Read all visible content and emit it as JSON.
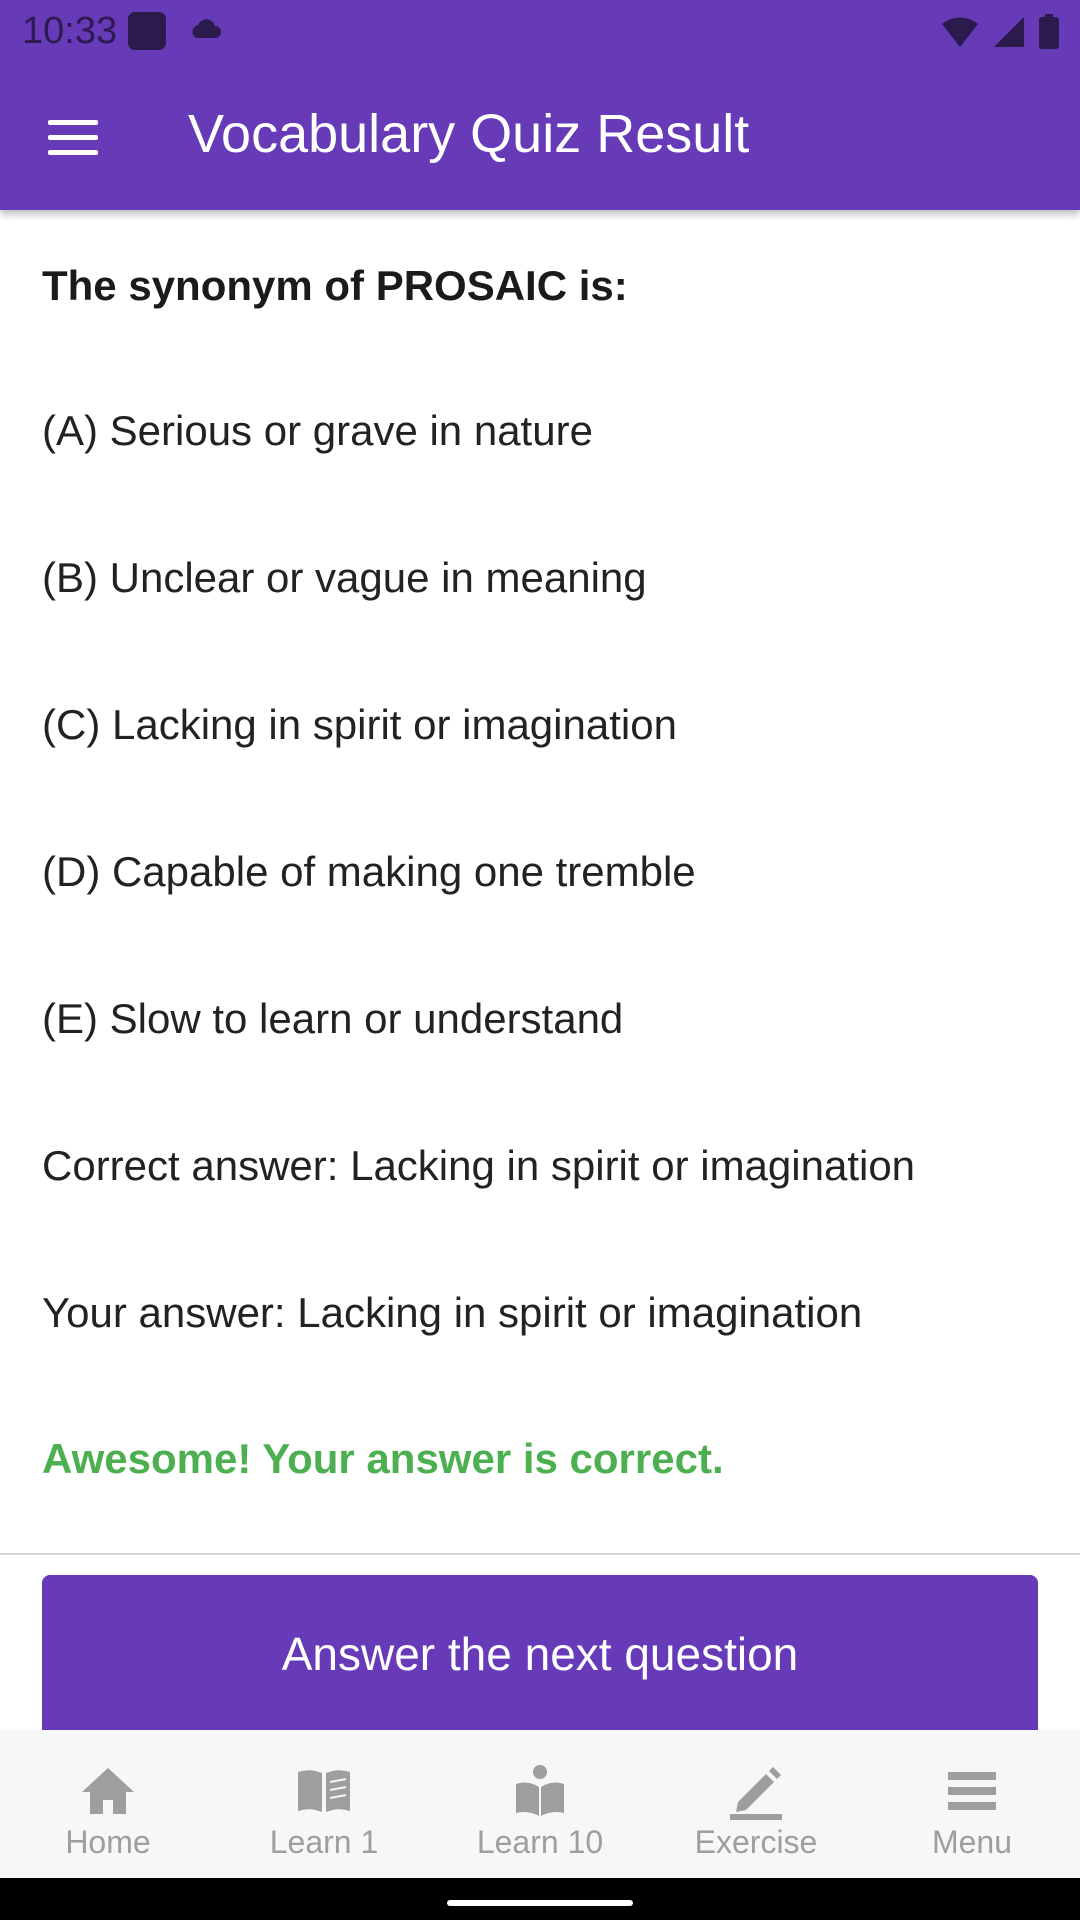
{
  "status_bar": {
    "time": "10:33"
  },
  "app_bar": {
    "title": "Vocabulary Quiz Result",
    "menu_icon": "hamburger-menu-icon"
  },
  "quiz": {
    "question": "The synonym of PROSAIC is:",
    "options": [
      "(A) Serious or grave in nature",
      "(B) Unclear or vague in meaning",
      "(C) Lacking in spirit or imagination",
      "(D) Capable of making one tremble",
      "(E) Slow to learn or understand"
    ],
    "correct_answer": "Correct answer: Lacking in spirit or imagination",
    "your_answer": "Your answer: Lacking in spirit or imagination",
    "feedback": "Awesome! Your answer is correct."
  },
  "next_button": {
    "label": "Answer the next question"
  },
  "bottom_nav": [
    {
      "label": "Home",
      "icon": "home-icon"
    },
    {
      "label": "Learn 1",
      "icon": "book-icon"
    },
    {
      "label": "Learn 10",
      "icon": "reader-icon"
    },
    {
      "label": "Exercise",
      "icon": "pencil-icon"
    },
    {
      "label": "Menu",
      "icon": "menu-icon"
    }
  ],
  "colors": {
    "primary": "#673ab7",
    "success": "#4caf50",
    "nav_inactive": "#9e9e9e"
  }
}
